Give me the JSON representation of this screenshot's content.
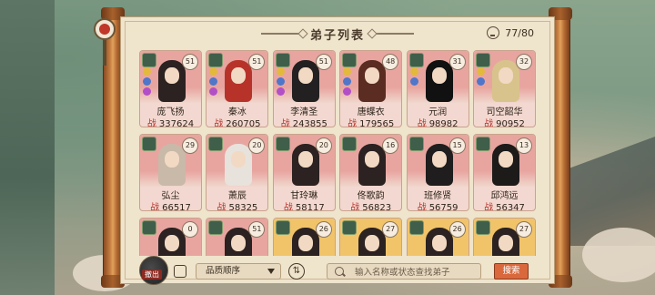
{
  "panel": {
    "title": "弟子列表",
    "count": "77/80"
  },
  "disciples": [
    {
      "name": "庞飞扬",
      "level": "51",
      "power": "337624",
      "bg": "#e8a5a0",
      "hair": "#2b2221"
    },
    {
      "name": "秦冰",
      "level": "51",
      "power": "260705",
      "bg": "#e8a5a0",
      "hair": "#b7332a"
    },
    {
      "name": "李清圣",
      "level": "51",
      "power": "243855",
      "bg": "#e8a5a0",
      "hair": "#232021"
    },
    {
      "name": "唐蝶衣",
      "level": "48",
      "power": "179565",
      "bg": "#e8a5a0",
      "hair": "#5a2c22"
    },
    {
      "name": "元润",
      "level": "31",
      "power": "98982",
      "bg": "#e8a5a0",
      "hair": "#111111"
    },
    {
      "name": "司空韶华",
      "level": "32",
      "power": "90952",
      "bg": "#e8a5a0",
      "hair": "#d8c38c"
    },
    {
      "name": "弘尘",
      "level": "29",
      "power": "66517",
      "bg": "#e8a5a0",
      "hair": "#c9b9a8"
    },
    {
      "name": "萧辰",
      "level": "20",
      "power": "58325",
      "bg": "#e8a5a0",
      "hair": "#e8e2dc"
    },
    {
      "name": "甘玲琳",
      "level": "20",
      "power": "58117",
      "bg": "#e8a5a0",
      "hair": "#2b2221"
    },
    {
      "name": "佟歌韵",
      "level": "16",
      "power": "56823",
      "bg": "#e8a5a0",
      "hair": "#2b2221"
    },
    {
      "name": "班修贤",
      "level": "15",
      "power": "56759",
      "bg": "#e8a5a0",
      "hair": "#1f1d1d"
    },
    {
      "name": "邱鸿远",
      "level": "13",
      "power": "56347",
      "bg": "#e8a5a0",
      "hair": "#1d1a1a"
    },
    {
      "name": "",
      "level": "0",
      "power": "",
      "bg": "#e8a5a0",
      "hair": "#2b2221"
    },
    {
      "name": "",
      "level": "51",
      "power": "",
      "bg": "#e8a5a0",
      "hair": "#2b2221"
    },
    {
      "name": "",
      "level": "26",
      "power": "",
      "bg": "#f1c46a",
      "hair": "#2b2221"
    },
    {
      "name": "",
      "level": "27",
      "power": "",
      "bg": "#f1c46a",
      "hair": "#2b2221"
    },
    {
      "name": "",
      "level": "26",
      "power": "",
      "bg": "#f1c46a",
      "hair": "#2b2221"
    },
    {
      "name": "",
      "level": "27",
      "power": "",
      "bg": "#f1c46a",
      "hair": "#2b2221"
    }
  ],
  "power_prefix": "战",
  "bottom": {
    "back_label": "撤出",
    "sort_label": "品质顺序",
    "search_placeholder": "输入名称或状态查找弟子",
    "search_button": "搜索"
  },
  "icons": {
    "count": "disciple-count-icon",
    "filter": "filter-icon",
    "swap": "swap-order-icon",
    "search": "search-icon"
  }
}
